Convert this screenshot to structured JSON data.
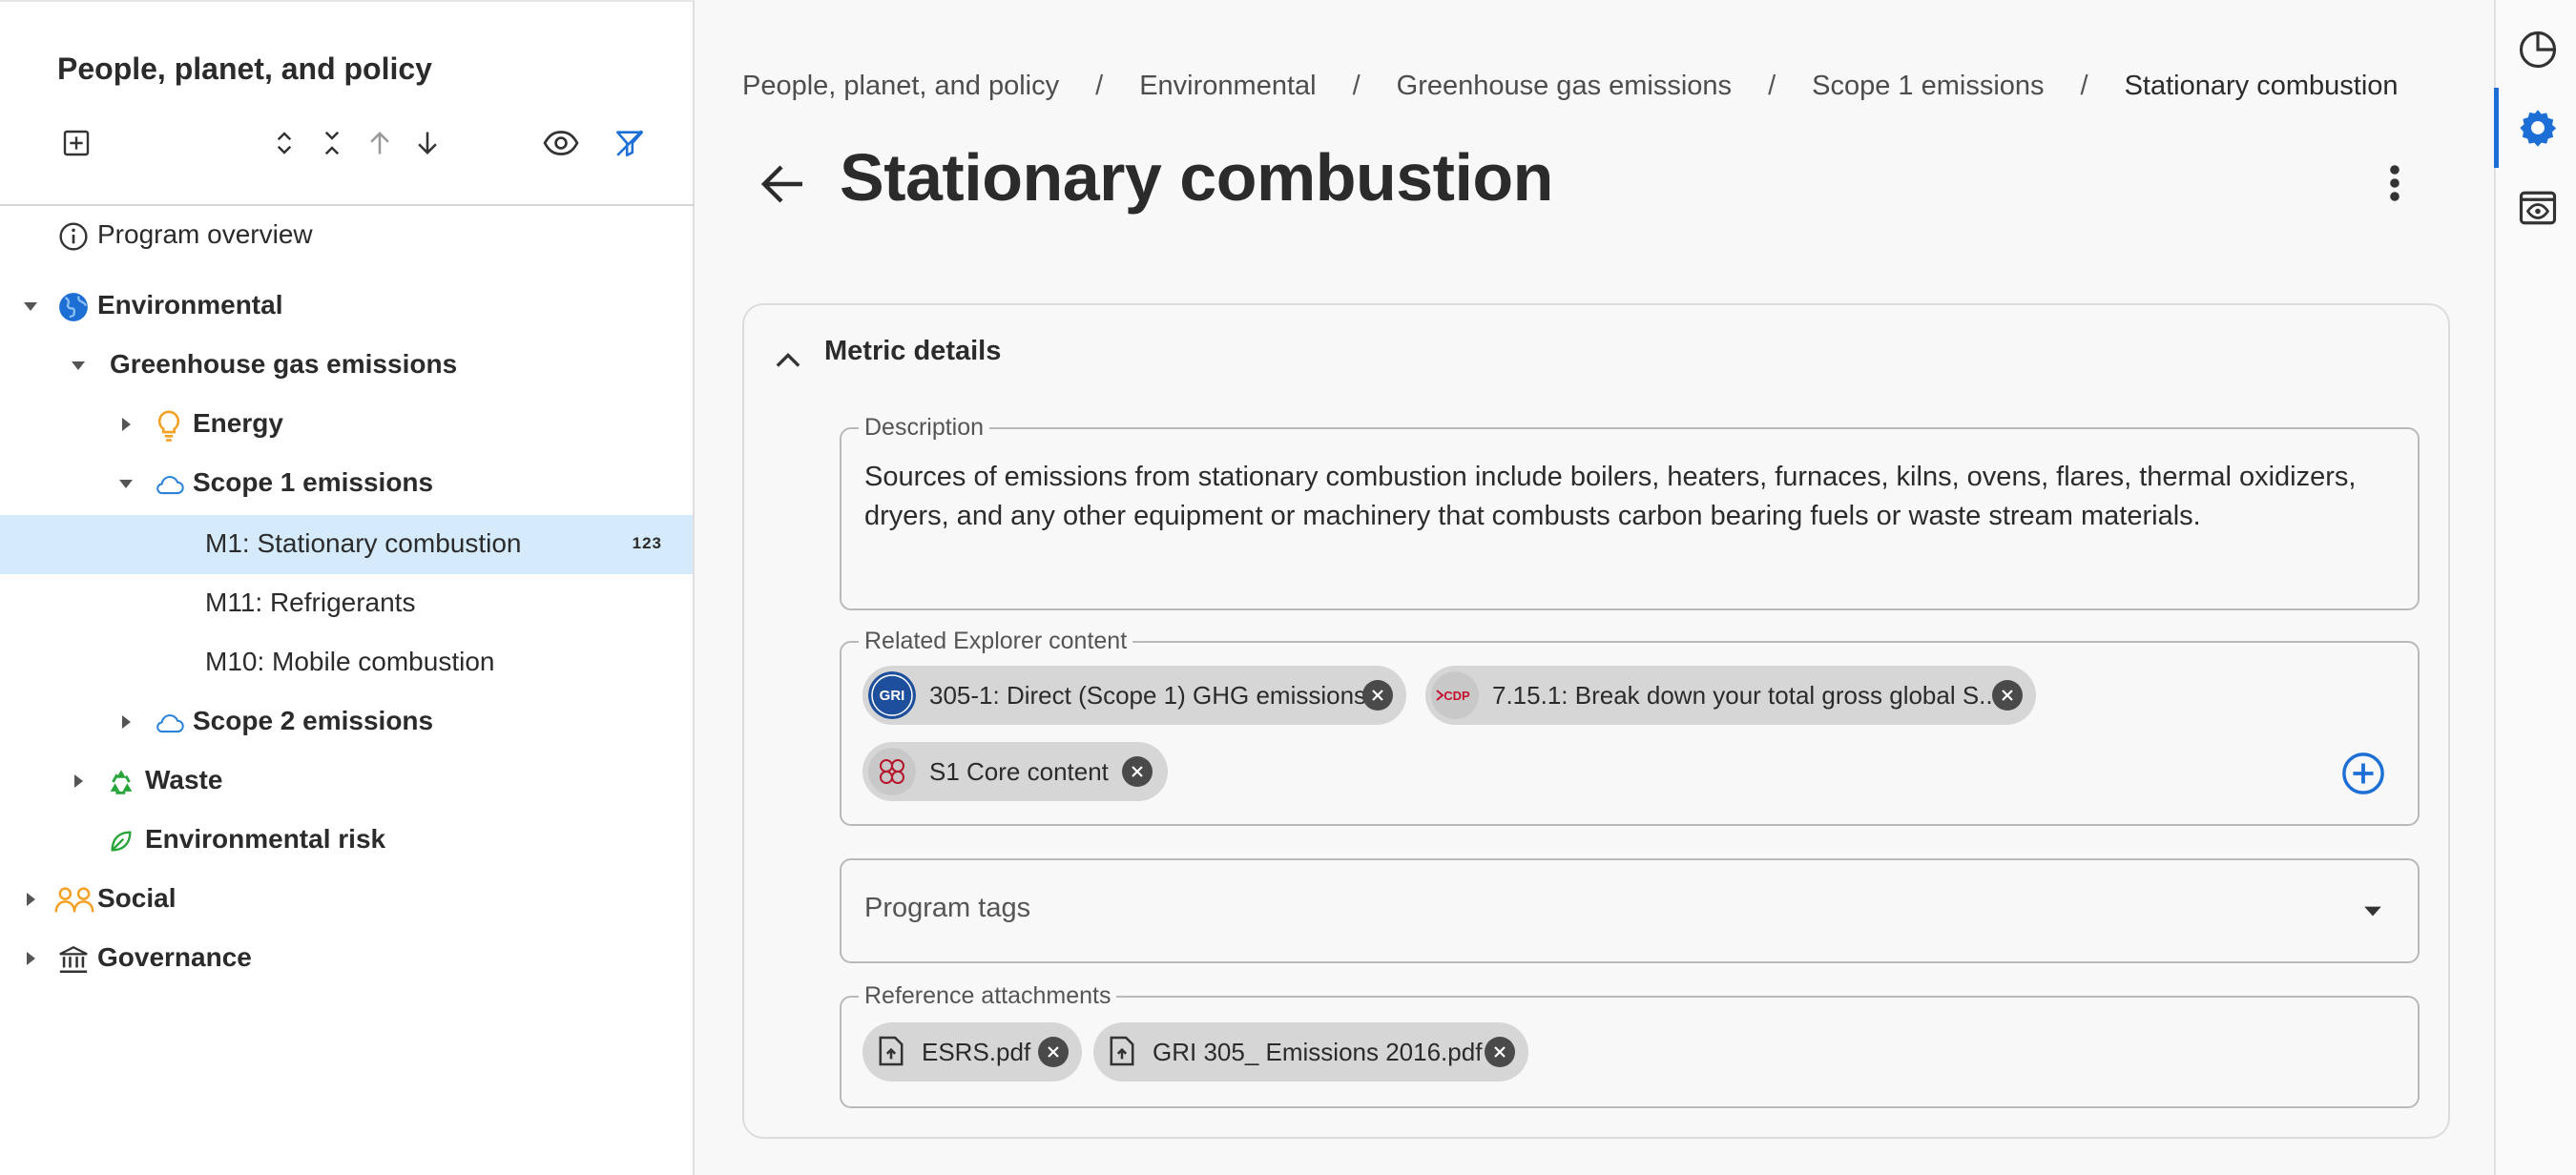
{
  "program": {
    "title": "People, planet, and policy"
  },
  "toolbar": {
    "icons": [
      "add-box-icon",
      "expand-all-icon",
      "collapse-all-icon",
      "arrow-up-icon",
      "arrow-down-icon",
      "eye-icon",
      "filter-off-icon"
    ]
  },
  "tree": {
    "items": [
      {
        "label": "Program overview",
        "icon": "info-icon"
      },
      {
        "label": "Environmental",
        "icon": "globe-icon"
      },
      {
        "label": "Greenhouse gas emissions"
      },
      {
        "label": "Energy",
        "icon": "lightbulb-icon"
      },
      {
        "label": "Scope 1 emissions",
        "icon": "cloud-icon"
      },
      {
        "label": "M1: Stationary combustion",
        "badge": "123"
      },
      {
        "label": "M11: Refrigerants"
      },
      {
        "label": "M10: Mobile combustion"
      },
      {
        "label": "Scope 2 emissions",
        "icon": "cloud-icon"
      },
      {
        "label": "Waste",
        "icon": "recycle-icon"
      },
      {
        "label": "Environmental risk",
        "icon": "leaf-icon"
      },
      {
        "label": "Social",
        "icon": "people-icon"
      },
      {
        "label": "Governance",
        "icon": "bank-icon"
      }
    ]
  },
  "breadcrumb": {
    "items": [
      "People, planet, and policy",
      "Environmental",
      "Greenhouse gas emissions",
      "Scope 1 emissions",
      "Stationary combustion"
    ],
    "separator": "/"
  },
  "page": {
    "title": "Stationary combustion"
  },
  "metric_details": {
    "title": "Metric details",
    "description": {
      "label": "Description",
      "value": "Sources of emissions from stationary combustion include boilers, heaters, furnaces, kilns, ovens, flares, thermal oxidizers, dryers, and any other equipment or machinery that combusts carbon bearing fuels or waste stream materials."
    },
    "related": {
      "label": "Related Explorer content",
      "chips": [
        {
          "logo": "GRI",
          "label": "305-1: Direct (Scope 1) GHG emissions"
        },
        {
          "logo": "CDP",
          "label": "7.15.1: Break down your total gross global S..."
        },
        {
          "logo": "ESRS",
          "label": "S1 Core content"
        }
      ]
    },
    "tags": {
      "placeholder": "Program tags"
    },
    "attachments": {
      "label": "Reference attachments",
      "files": [
        "ESRS.pdf",
        "GRI 305_ Emissions 2016.pdf"
      ]
    }
  },
  "colors": {
    "accent": "#1d6fd6",
    "selected_row": "#d5ebfb",
    "chip": "#d6d6d6"
  }
}
